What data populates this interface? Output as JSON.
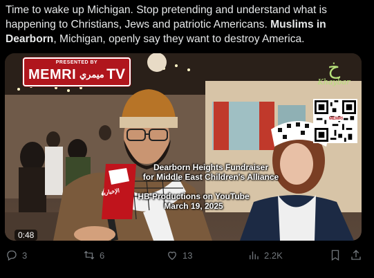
{
  "tweet": {
    "text_before": "Time to wake up Michigan. Stop pretending and understand what is happening to Christians, Jews and patriotic Americans. ",
    "text_bold1": "Muslims in Dearborn",
    "text_after": ", Michigan, openly say they want to destroy America."
  },
  "video": {
    "memri_presented": "PRESENTED BY",
    "memri_brand": "MEMRI",
    "memri_arabic": "ميمري",
    "memri_tv": "TV",
    "khaybar_name": "Khaybar",
    "qr_label": "MEMRI",
    "caption_line1": "Dearborn Heights Fundraiser",
    "caption_line2": "for Middle East Children's Alliance",
    "caption_line3": "HB Productions on YouTube",
    "caption_line4": "March 19, 2025",
    "mic_label": "الإخبارية",
    "duration": "0:48"
  },
  "actions": {
    "replies": "3",
    "reposts": "6",
    "likes": "13",
    "views": "2.2K"
  },
  "colors": {
    "text": "#e7e9ea",
    "muted": "#71767b",
    "memri_red": "#b0161d",
    "background": "#000000"
  }
}
